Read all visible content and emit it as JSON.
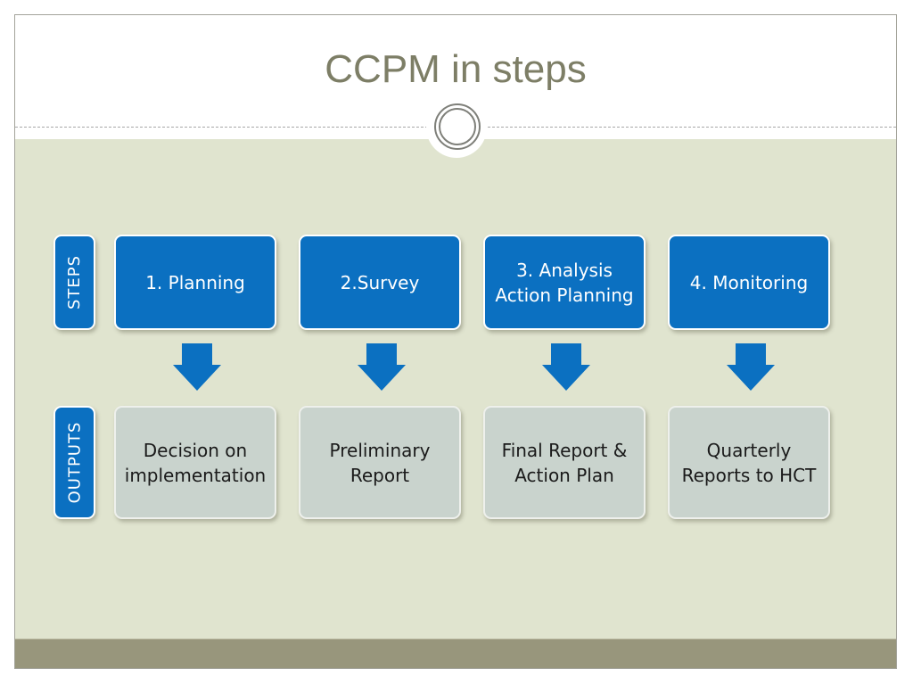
{
  "slide": {
    "title": "CCPM in steps",
    "colors": {
      "title": "#7d7e66",
      "step_fill": "#0b70c1",
      "output_fill": "#c9d3cd",
      "panel_background": "#e0e4cf",
      "footer_band": "#98967c"
    },
    "row_labels": {
      "steps": "STEPS",
      "outputs": "OUTPUTS"
    },
    "steps": [
      {
        "label": "1. Planning",
        "output": "Decision on implementation"
      },
      {
        "label": "2.Survey",
        "output": "Preliminary Report"
      },
      {
        "label": "3. Analysis Action Planning",
        "output": "Final Report & Action Plan"
      },
      {
        "label": "4. Monitoring",
        "output": "Quarterly Reports to HCT"
      }
    ],
    "step_lines": [
      [
        "1. Planning"
      ],
      [
        "2.Survey"
      ],
      [
        "3. Analysis",
        "Action Planning"
      ],
      [
        "4. Monitoring"
      ]
    ],
    "output_lines": [
      [
        "Decision on",
        "implementation"
      ],
      [
        "Preliminary",
        "Report"
      ],
      [
        "Final Report &",
        "Action Plan"
      ],
      [
        "Quarterly",
        "Reports to HCT"
      ]
    ]
  }
}
